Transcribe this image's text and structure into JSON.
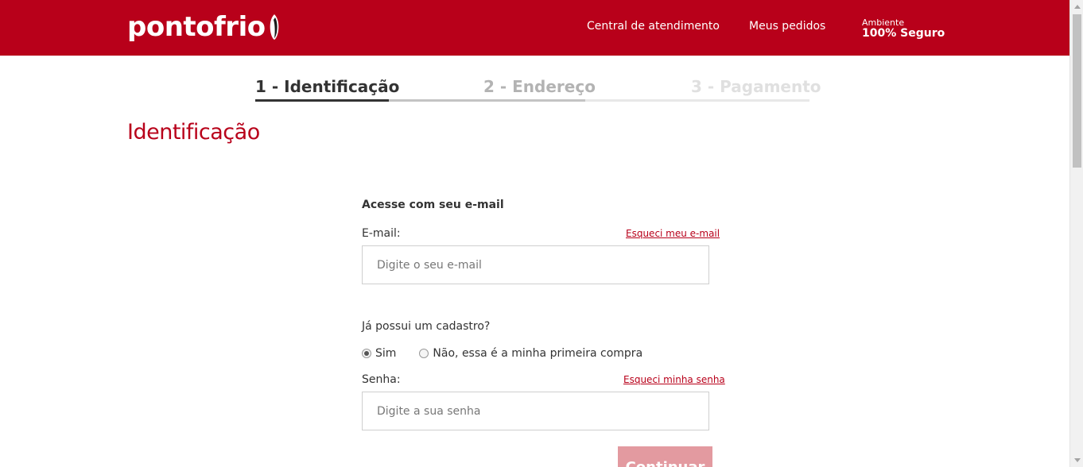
{
  "header": {
    "logo_text": "pontofrio",
    "nav": {
      "central": "Central de atendimento",
      "pedidos": "Meus pedidos"
    },
    "secure_small": "Ambiente",
    "secure_big": "100% Seguro"
  },
  "steps": [
    {
      "label": "1 - Identificação",
      "state": "active"
    },
    {
      "label": "2 - Endereço",
      "state": "next"
    },
    {
      "label": "3 - Pagamento",
      "state": "future"
    }
  ],
  "page_title": "Identificação",
  "form": {
    "section_title": "Acesse com seu e-mail",
    "email_label": "E-mail:",
    "forgot_email": "Esqueci meu e-mail",
    "email_placeholder": "Digite o seu e-mail",
    "email_value": "",
    "has_account_question": "Já possui um cadastro?",
    "radio_yes": "Sim",
    "radio_no": "Não, essa é a minha primeira compra",
    "selected_option": "Sim",
    "password_label": "Senha:",
    "forgot_password": "Esqueci minha senha",
    "password_placeholder": "Digite a sua senha",
    "password_value": "",
    "continue_button": "Continuar"
  },
  "colors": {
    "brand": "#b8001a",
    "step_active": "#333333",
    "step_next": "#b3b3b3",
    "step_future": "#e0e0e0",
    "button_disabled": "#e39aa0"
  }
}
